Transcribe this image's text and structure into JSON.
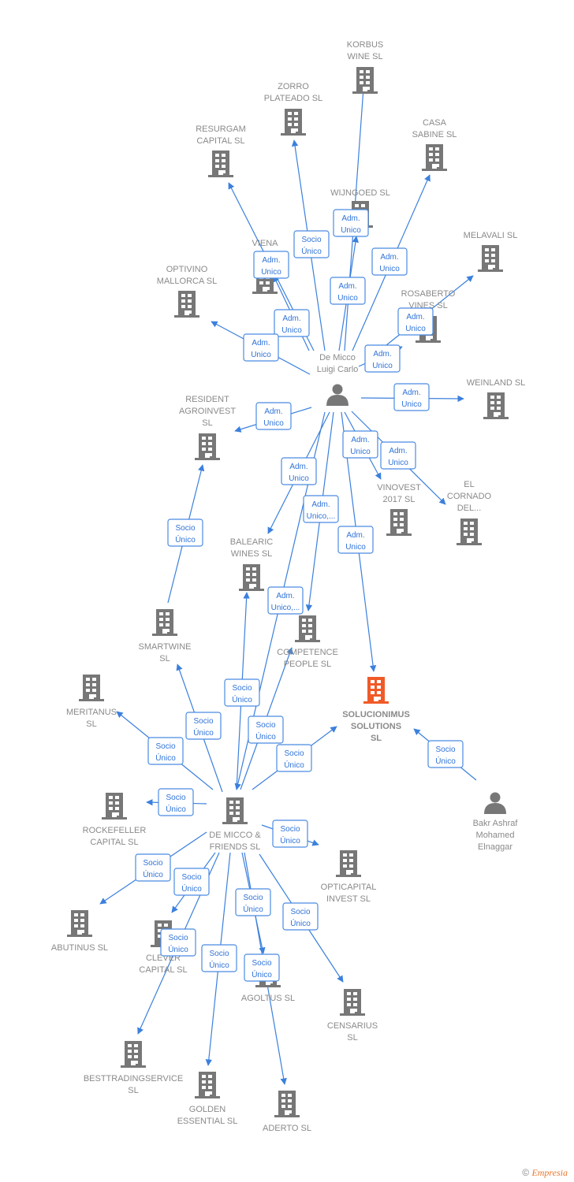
{
  "colors": {
    "edge": "#3b80dd",
    "company": "#777777",
    "highlight": "#f05a28",
    "label": "#8a8a8a"
  },
  "nodes": [
    {
      "id": "korbus",
      "type": "company",
      "label": [
        "KORBUS",
        "WINE  SL"
      ]
    },
    {
      "id": "zorro",
      "type": "company",
      "label": [
        "ZORRO",
        "PLATEADO  SL"
      ]
    },
    {
      "id": "resurgam",
      "type": "company",
      "label": [
        "RESURGAM",
        "CAPITAL  SL"
      ]
    },
    {
      "id": "casa",
      "type": "company",
      "label": [
        "CASA",
        "SABINE  SL"
      ]
    },
    {
      "id": "wijngoed",
      "type": "company",
      "label": [
        "WIJNGOED  SL"
      ]
    },
    {
      "id": "melavali",
      "type": "company",
      "label": [
        "MELAVALI  SL"
      ]
    },
    {
      "id": "viena",
      "type": "company",
      "label": [
        "VIENA",
        "VES"
      ]
    },
    {
      "id": "optivino",
      "type": "company",
      "label": [
        "OPTIVINO",
        "MALLORCA  SL"
      ]
    },
    {
      "id": "rosaberto",
      "type": "company",
      "label": [
        "ROSABERTO",
        "VINES  SL"
      ]
    },
    {
      "id": "weinland",
      "type": "company",
      "label": [
        "WEINLAND  SL"
      ]
    },
    {
      "id": "resident",
      "type": "company",
      "label": [
        "RESIDENT",
        "AGROINVEST",
        "SL"
      ]
    },
    {
      "id": "demicco",
      "type": "person",
      "label": [
        "De Micco",
        "Luigi Carlo"
      ]
    },
    {
      "id": "vinovest",
      "type": "company",
      "label": [
        "VINOVEST",
        "2017  SL"
      ]
    },
    {
      "id": "cornado",
      "type": "company",
      "label": [
        "EL",
        "CORNADO",
        "DEL..."
      ]
    },
    {
      "id": "balearic",
      "type": "company",
      "label": [
        "BALEARIC",
        "WINES  SL"
      ]
    },
    {
      "id": "competence",
      "type": "company",
      "label": [
        "COMPETENCE",
        "PEOPLE  SL"
      ]
    },
    {
      "id": "smartwine",
      "type": "company",
      "label": [
        "SMARTWINE",
        "SL"
      ]
    },
    {
      "id": "solucionimus",
      "type": "company",
      "highlight": true,
      "label": [
        "SOLUCIONIMUS",
        "SOLUTIONS",
        "SL"
      ]
    },
    {
      "id": "meritanus",
      "type": "company",
      "label": [
        "MERITANUS",
        "SL"
      ]
    },
    {
      "id": "bakr",
      "type": "person",
      "label": [
        "Bakr Ashraf",
        "Mohamed",
        "Elnaggar"
      ]
    },
    {
      "id": "friends",
      "type": "company",
      "label": [
        "DE MICCO &",
        "FRIENDS  SL"
      ]
    },
    {
      "id": "rockefeller",
      "type": "company",
      "label": [
        "ROCKEFELLER",
        "CAPITAL  SL"
      ]
    },
    {
      "id": "opticapital",
      "type": "company",
      "label": [
        "OPTICAPITAL",
        "INVEST  SL"
      ]
    },
    {
      "id": "abutinus",
      "type": "company",
      "label": [
        "ABUTINUS  SL"
      ]
    },
    {
      "id": "clever",
      "type": "company",
      "label": [
        "CLEVER",
        "CAPITAL  SL"
      ]
    },
    {
      "id": "agoltus",
      "type": "company",
      "label": [
        "AGOLTUS  SL"
      ]
    },
    {
      "id": "censarius",
      "type": "company",
      "label": [
        "CENSARIUS",
        "SL"
      ]
    },
    {
      "id": "besttrading",
      "type": "company",
      "label": [
        "BESTTRADINGSERVICE",
        "SL"
      ]
    },
    {
      "id": "golden",
      "type": "company",
      "label": [
        "GOLDEN",
        "ESSENTIAL  SL"
      ]
    },
    {
      "id": "aderto",
      "type": "company",
      "label": [
        "ADERTO  SL"
      ]
    }
  ],
  "edges": [
    {
      "from": "demicco",
      "to": "korbus",
      "label": [
        "Adm.",
        "Unico"
      ]
    },
    {
      "from": "demicco",
      "to": "wijngoed",
      "label": [
        "Adm.",
        "Unico"
      ]
    },
    {
      "from": "demicco",
      "to": "zorro",
      "label": [
        "Socio",
        "Único"
      ]
    },
    {
      "from": "demicco",
      "to": "resurgam",
      "label": [
        "Adm.",
        "Unico"
      ]
    },
    {
      "from": "demicco",
      "to": "viena",
      "label": [
        "Adm.",
        "Unico"
      ]
    },
    {
      "from": "demicco",
      "to": "optivino",
      "label": [
        "Adm.",
        "Unico"
      ]
    },
    {
      "from": "demicco",
      "to": "casa",
      "label": [
        "Adm.",
        "Unico"
      ]
    },
    {
      "from": "demicco",
      "to": "rosaberto",
      "label": [
        "Adm.",
        "Unico"
      ]
    },
    {
      "from": "demicco",
      "to": "melavali",
      "label": [
        "Adm.",
        "Unico"
      ]
    },
    {
      "from": "demicco",
      "to": "weinland",
      "label": [
        "Adm.",
        "Unico"
      ]
    },
    {
      "from": "demicco",
      "to": "resident",
      "label": [
        "Adm.",
        "Unico"
      ]
    },
    {
      "from": "demicco",
      "to": "vinovest",
      "label": [
        "Adm.",
        "Unico"
      ]
    },
    {
      "from": "demicco",
      "to": "cornado",
      "label": [
        "Adm.",
        "Unico"
      ]
    },
    {
      "from": "demicco",
      "to": "balearic",
      "label": [
        "Adm.",
        "Unico"
      ]
    },
    {
      "from": "demicco",
      "to": "competence",
      "label": [
        "Adm.",
        "Unico,..."
      ]
    },
    {
      "from": "demicco",
      "to": "solucionimus",
      "label": [
        "Adm.",
        "Unico"
      ]
    },
    {
      "from": "demicco",
      "to": "friends",
      "label": [
        "Adm.",
        "Unico,..."
      ]
    },
    {
      "from": "friends",
      "to": "smartwine",
      "label": [
        "Socio",
        "Único"
      ]
    },
    {
      "from": "friends",
      "to": "balearic",
      "label": [
        "Socio",
        "Único"
      ]
    },
    {
      "from": "friends",
      "to": "competence",
      "label": [
        "Socio",
        "Único"
      ]
    },
    {
      "from": "friends",
      "to": "solucionimus",
      "label": [
        "Socio",
        "Único"
      ]
    },
    {
      "from": "friends",
      "to": "meritanus",
      "label": [
        "Socio",
        "Único"
      ]
    },
    {
      "from": "friends",
      "to": "rockefeller",
      "label": [
        "Socio",
        "Único"
      ]
    },
    {
      "from": "friends",
      "to": "opticapital",
      "label": [
        "Socio",
        "Único"
      ]
    },
    {
      "from": "friends",
      "to": "abutinus",
      "label": [
        "Socio",
        "Único"
      ]
    },
    {
      "from": "friends",
      "to": "clever",
      "label": [
        "Socio",
        "Único"
      ]
    },
    {
      "from": "friends",
      "to": "besttrading",
      "label": [
        "Socio",
        "Único"
      ]
    },
    {
      "from": "friends",
      "to": "golden",
      "label": [
        "Socio",
        "Único"
      ]
    },
    {
      "from": "friends",
      "to": "agoltus",
      "label": [
        "Socio",
        "Único"
      ]
    },
    {
      "from": "friends",
      "to": "aderto",
      "label": [
        "Socio",
        "Único"
      ]
    },
    {
      "from": "friends",
      "to": "censarius",
      "label": [
        "Socio",
        "Único"
      ]
    },
    {
      "from": "bakr",
      "to": "solucionimus",
      "label": [
        "Socio",
        "Único"
      ]
    },
    {
      "from": "smartwine",
      "to": "resident",
      "label": [
        "Socio",
        "Único"
      ]
    }
  ],
  "footer": {
    "copyright": "©",
    "brand": "Empresia"
  }
}
